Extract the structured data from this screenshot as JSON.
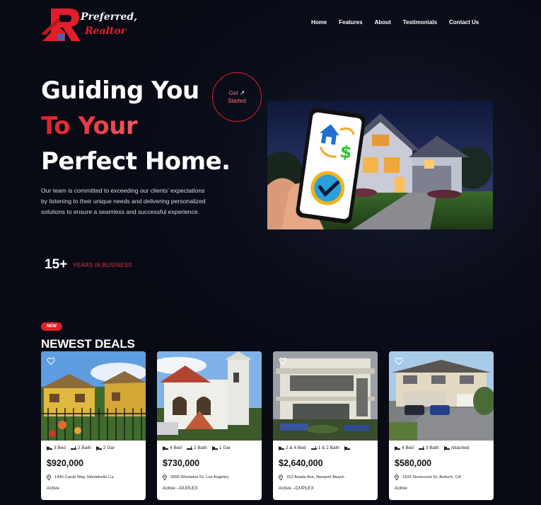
{
  "brand": {
    "line1": "Preferred,",
    "line2": "Realtor"
  },
  "nav": [
    "Home",
    "Features",
    "About",
    "Testimonials",
    "Contact Us"
  ],
  "hero": {
    "line1": "Guiding You",
    "line2": "To Your",
    "line3": "Perfect Home.",
    "cta_line1": "Get",
    "cta_line2": "Started",
    "cta_arrow": "↗",
    "description": "Our team is committed to exceeding our clients' expectations by listening to their unique needs and delivering personalized solutions to ensure a seamless and successful experience."
  },
  "stat": {
    "value": "15+",
    "label": "YEARS IN BUSINESS"
  },
  "deals": {
    "badge": "NEW",
    "title": "NEWEST DEALS",
    "cards": [
      {
        "bed": "3 Bed",
        "bath": "2 Bath",
        "extra": "2 Gar",
        "price": "$920,000",
        "address": "1440 Carob Way, Montebello Ca.",
        "status": "Active"
      },
      {
        "bed": "4 Bed",
        "bath": "2 Bath",
        "extra": "1 Gar",
        "price": "$730,000",
        "address": "3900 Woolwine Dr, Los Angeles,",
        "status": "Active --DUPLEX"
      },
      {
        "bed": "2 & 4 Bed",
        "bath": "1 & 2 Bath",
        "extra": "",
        "price": "$2,640,000",
        "address": "312 Anade Ave, Newport Beach",
        "status": "Active --DUPLEX"
      },
      {
        "bed": "4 Bed",
        "bath": "3 Bath",
        "extra": "Attached",
        "price": "$580,000",
        "address": "1109 Stonecrest Dr, Antioch, CA",
        "status": "Active"
      }
    ]
  },
  "colors": {
    "accent": "#e01f2b",
    "background": "#0b0e1a"
  }
}
